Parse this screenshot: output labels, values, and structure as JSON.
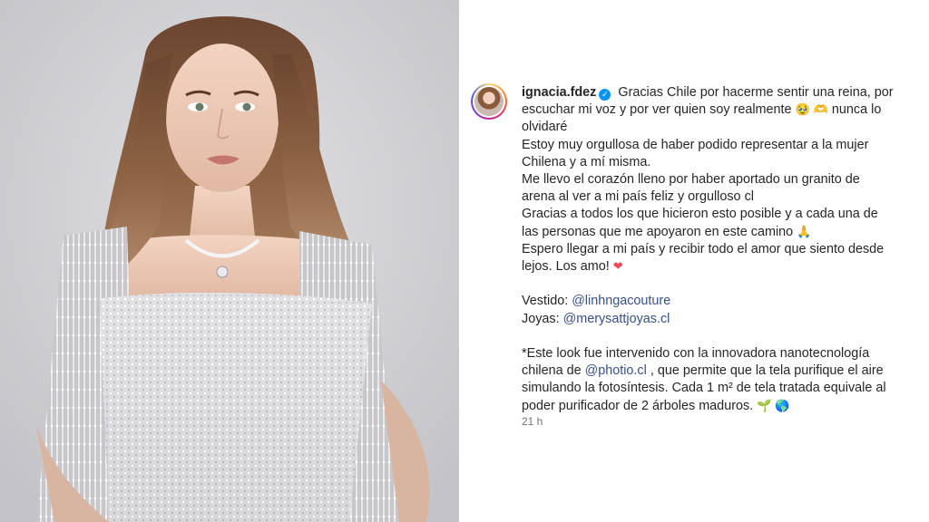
{
  "post": {
    "image_alt": "Woman in silver sequined gown with fringe sleeves",
    "username": "ignacia.fdez",
    "verified": true,
    "caption": {
      "line1": "Gracias Chile por hacerme sentir una reina, por escuchar mi voz y por ver quien soy realmente",
      "line1_end": "nunca lo olvidaré",
      "emoji_1": "🥹",
      "emoji_2": "🫶",
      "line2": "Estoy muy orgullosa de haber podido representar a la mujer Chilena y a mí misma.",
      "line3": "Me llevo el corazón lleno por haber aportado un granito de arena al ver a mi país feliz y orgulloso",
      "flag": "cl",
      "line4": "Gracias a todos los que hicieron esto posible y a cada una de las personas que me apoyaron en este camino",
      "emoji_pray": "🙏",
      "line5": "Espero llegar a mi país y recibir todo el amor que siento desde lejos. Los amo!",
      "emoji_heart": "❤",
      "dress_label": "Vestido:",
      "dress_mention": "@linhngacouture",
      "jewelry_label": "Joyas:",
      "jewelry_mention": "@merysattjoyas.cl",
      "note_start": "*Este look fue intervenido con la innovadora nanotecnología chilena de",
      "note_mention": "@photio.cl",
      "note_end": ", que permite que la tela purifique el aire simulando la fotosíntesis. Cada 1 m² de tela tratada equivale al poder purificador de 2 árboles maduros.",
      "emoji_plant": "🌱",
      "emoji_globe": "🌎"
    },
    "timestamp": "21 h"
  },
  "colors": {
    "mention": "#385185",
    "verified": "#0095f6",
    "text": "#262626",
    "meta": "#737373"
  }
}
